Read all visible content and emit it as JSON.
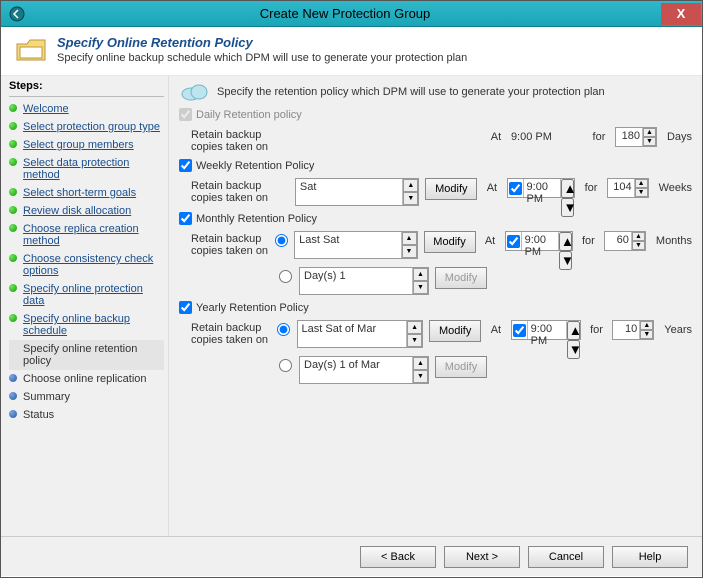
{
  "titlebar": {
    "title": "Create New Protection Group",
    "close": "X"
  },
  "header": {
    "title": "Specify Online Retention Policy",
    "subtitle": "Specify online backup schedule which DPM will use to generate your protection plan"
  },
  "steps": {
    "heading": "Steps:",
    "items": [
      {
        "label": "Welcome",
        "state": "completed"
      },
      {
        "label": "Select protection group type",
        "state": "completed"
      },
      {
        "label": "Select group members",
        "state": "completed"
      },
      {
        "label": "Select data protection method",
        "state": "completed"
      },
      {
        "label": "Select short-term goals",
        "state": "completed"
      },
      {
        "label": "Review disk allocation",
        "state": "completed"
      },
      {
        "label": "Choose replica creation method",
        "state": "completed"
      },
      {
        "label": "Choose consistency check options",
        "state": "completed"
      },
      {
        "label": "Specify online protection data",
        "state": "completed"
      },
      {
        "label": "Specify online backup schedule",
        "state": "completed"
      },
      {
        "label": "Specify online retention policy",
        "state": "current"
      },
      {
        "label": "Choose online replication",
        "state": "pending"
      },
      {
        "label": "Summary",
        "state": "pending"
      },
      {
        "label": "Status",
        "state": "pending"
      }
    ]
  },
  "hint": "Specify the retention policy which DPM will use to generate your protection plan",
  "at_label": "At",
  "for_label": "for",
  "retain_label": "Retain backup copies taken on",
  "modify_label": "Modify",
  "daily": {
    "cb_label": "Daily Retention policy",
    "time": "9:00 PM",
    "duration": "180",
    "unit": "Days"
  },
  "weekly": {
    "cb_label": "Weekly Retention Policy",
    "value": "Sat",
    "time": "9:00 PM",
    "duration": "104",
    "unit": "Weeks"
  },
  "monthly": {
    "cb_label": "Monthly Retention Policy",
    "opt1": "Last Sat",
    "opt2": "Day(s) 1",
    "time": "9:00 PM",
    "duration": "60",
    "unit": "Months"
  },
  "yearly": {
    "cb_label": "Yearly Retention Policy",
    "opt1": "Last Sat of Mar",
    "opt2": "Day(s) 1 of Mar",
    "time": "9:00 PM",
    "duration": "10",
    "unit": "Years"
  },
  "footer": {
    "back": "< Back",
    "next": "Next >",
    "cancel": "Cancel",
    "help": "Help"
  }
}
